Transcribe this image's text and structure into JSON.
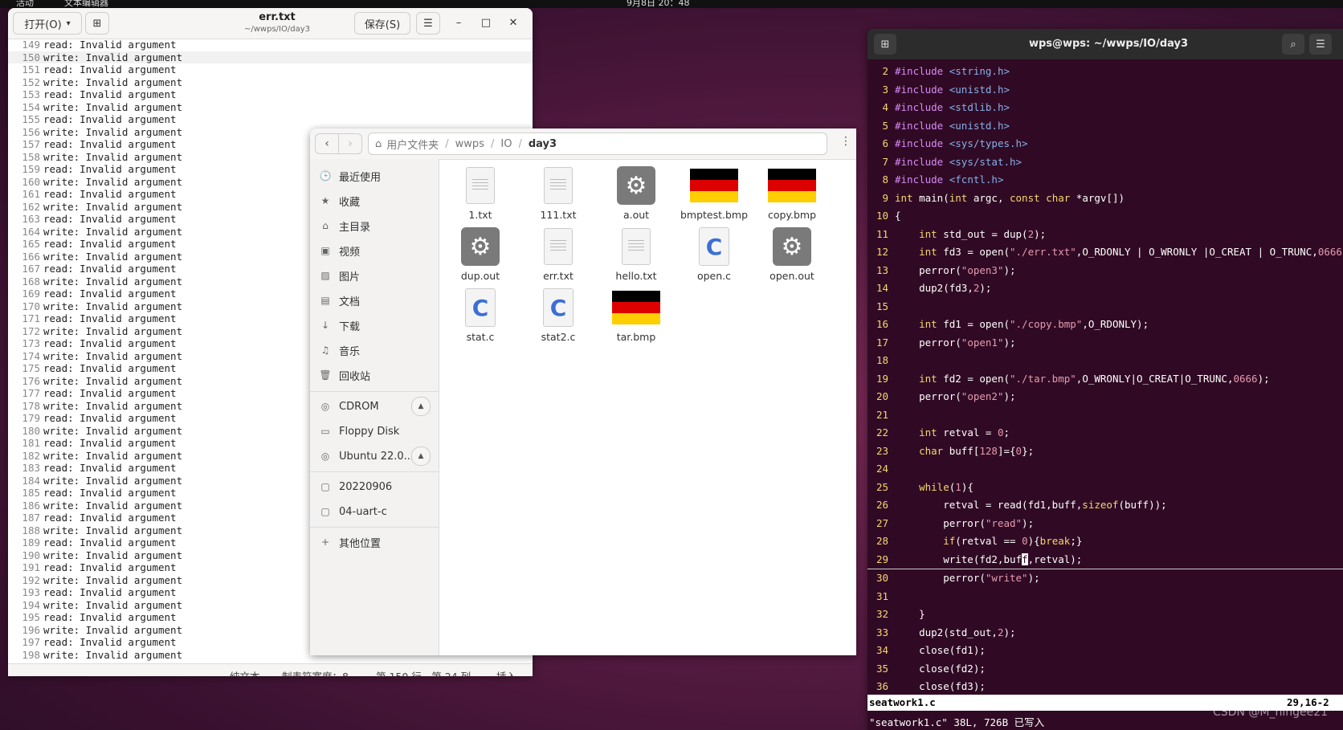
{
  "topbar": {
    "left1": "活动",
    "left2": "文本编辑器",
    "clock": "9月8日 20：48"
  },
  "editor": {
    "open_label": "打开(O)",
    "title": "err.txt",
    "subtitle": "~/wwps/IO/day3",
    "save_label": "保存(S)",
    "lines": [
      {
        "n": "149",
        "t": "read: Invalid argument"
      },
      {
        "n": "150",
        "t": "write: Invalid argument"
      },
      {
        "n": "151",
        "t": "read: Invalid argument"
      },
      {
        "n": "152",
        "t": "write: Invalid argument"
      },
      {
        "n": "153",
        "t": "read: Invalid argument"
      },
      {
        "n": "154",
        "t": "write: Invalid argument"
      },
      {
        "n": "155",
        "t": "read: Invalid argument"
      },
      {
        "n": "156",
        "t": "write: Invalid argument"
      },
      {
        "n": "157",
        "t": "read: Invalid argument"
      },
      {
        "n": "158",
        "t": "write: Invalid argument"
      },
      {
        "n": "159",
        "t": "read: Invalid argument"
      },
      {
        "n": "160",
        "t": "write: Invalid argument"
      },
      {
        "n": "161",
        "t": "read: Invalid argument"
      },
      {
        "n": "162",
        "t": "write: Invalid argument"
      },
      {
        "n": "163",
        "t": "read: Invalid argument"
      },
      {
        "n": "164",
        "t": "write: Invalid argument"
      },
      {
        "n": "165",
        "t": "read: Invalid argument"
      },
      {
        "n": "166",
        "t": "write: Invalid argument"
      },
      {
        "n": "167",
        "t": "read: Invalid argument"
      },
      {
        "n": "168",
        "t": "write: Invalid argument"
      },
      {
        "n": "169",
        "t": "read: Invalid argument"
      },
      {
        "n": "170",
        "t": "write: Invalid argument"
      },
      {
        "n": "171",
        "t": "read: Invalid argument"
      },
      {
        "n": "172",
        "t": "write: Invalid argument"
      },
      {
        "n": "173",
        "t": "read: Invalid argument"
      },
      {
        "n": "174",
        "t": "write: Invalid argument"
      },
      {
        "n": "175",
        "t": "read: Invalid argument"
      },
      {
        "n": "176",
        "t": "write: Invalid argument"
      },
      {
        "n": "177",
        "t": "read: Invalid argument"
      },
      {
        "n": "178",
        "t": "write: Invalid argument"
      },
      {
        "n": "179",
        "t": "read: Invalid argument"
      },
      {
        "n": "180",
        "t": "write: Invalid argument"
      },
      {
        "n": "181",
        "t": "read: Invalid argument"
      },
      {
        "n": "182",
        "t": "write: Invalid argument"
      },
      {
        "n": "183",
        "t": "read: Invalid argument"
      },
      {
        "n": "184",
        "t": "write: Invalid argument"
      },
      {
        "n": "185",
        "t": "read: Invalid argument"
      },
      {
        "n": "186",
        "t": "write: Invalid argument"
      },
      {
        "n": "187",
        "t": "read: Invalid argument"
      },
      {
        "n": "188",
        "t": "write: Invalid argument"
      },
      {
        "n": "189",
        "t": "read: Invalid argument"
      },
      {
        "n": "190",
        "t": "write: Invalid argument"
      },
      {
        "n": "191",
        "t": "read: Invalid argument"
      },
      {
        "n": "192",
        "t": "write: Invalid argument"
      },
      {
        "n": "193",
        "t": "read: Invalid argument"
      },
      {
        "n": "194",
        "t": "write: Invalid argument"
      },
      {
        "n": "195",
        "t": "read: Invalid argument"
      },
      {
        "n": "196",
        "t": "write: Invalid argument"
      },
      {
        "n": "197",
        "t": "read: Invalid argument"
      },
      {
        "n": "198",
        "t": "write: Invalid argument"
      }
    ],
    "current_line": "150",
    "status": {
      "mode": "纯文本",
      "tab": "制表符宽度：8",
      "pos": "第 150 行，第 24 列",
      "insert": "插入"
    }
  },
  "files": {
    "path": [
      "用户文件夹",
      "wwps",
      "IO",
      "day3"
    ],
    "sidebar": [
      "最近使用",
      "收藏",
      "主目录",
      "视频",
      "图片",
      "文档",
      "下载",
      "音乐",
      "回收站"
    ],
    "devices": [
      "CDROM",
      "Floppy Disk",
      "Ubuntu 22.0..."
    ],
    "bookmarks": [
      "20220906",
      "04-uart-c"
    ],
    "other": "其他位置",
    "items": [
      {
        "name": "1.txt",
        "type": "text"
      },
      {
        "name": "111.txt",
        "type": "text"
      },
      {
        "name": "a.out",
        "type": "exec"
      },
      {
        "name": "bmptest.bmp",
        "type": "image"
      },
      {
        "name": "copy.bmp",
        "type": "image"
      },
      {
        "name": "dup.out",
        "type": "exec"
      },
      {
        "name": "err.txt",
        "type": "text"
      },
      {
        "name": "hello.txt",
        "type": "text"
      },
      {
        "name": "open.c",
        "type": "c"
      },
      {
        "name": "open.out",
        "type": "exec"
      },
      {
        "name": "stat.c",
        "type": "c"
      },
      {
        "name": "stat2.c",
        "type": "c"
      },
      {
        "name": "tar.bmp",
        "type": "image"
      }
    ]
  },
  "terminal": {
    "title": "wps@wps: ~/wwps/IO/day3",
    "status_file": "seatwork1.c",
    "status_pos": "29,16-2",
    "message": "\"seatwork1.c\" 38L, 726B 已写入"
  },
  "watermark": "CSDN @M_ningee21",
  "colors": {
    "terminal_bg": "#300a24",
    "line_number": "#f5d76e",
    "preproc": "#d78af5",
    "string": "#e79ab0"
  }
}
